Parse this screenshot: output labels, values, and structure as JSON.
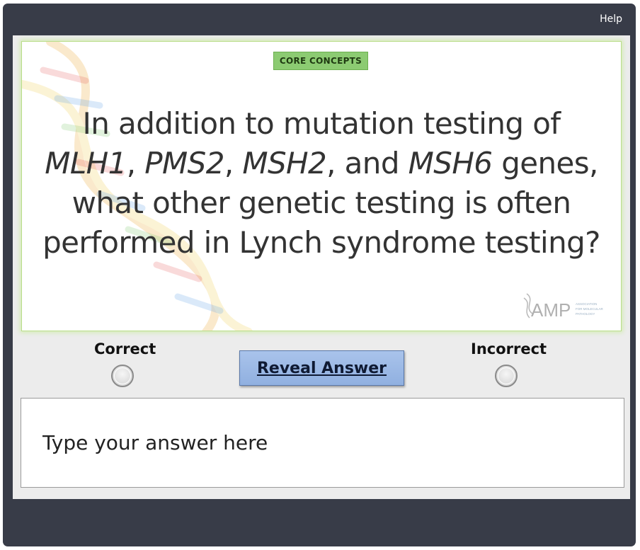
{
  "toolbar": {
    "help_label": "Help"
  },
  "card": {
    "tag": "CORE CONCEPTS",
    "question": {
      "l1": "In addition to mutation testing of",
      "g1": "MLH1",
      "s1": ", ",
      "g2": "PMS2",
      "s2": ", ",
      "g3": "MSH2",
      "s3": ", and ",
      "g4": "MSH6",
      "s4": " genes,",
      "l3": "what other genetic testing is often",
      "l4": "performed in Lynch syndrome testing?"
    },
    "logo": {
      "name": "AMP",
      "sub1": "ASSOCIATION",
      "sub2": "FOR MOLECULAR",
      "sub3": "PATHOLOGY"
    }
  },
  "options": {
    "correct_label": "Correct",
    "incorrect_label": "Incorrect",
    "reveal_label": "Reveal Answer"
  },
  "answer": {
    "placeholder": "Type your answer here"
  },
  "colors": {
    "frame": "#383c48",
    "tag_bg": "#8ccb72",
    "card_border": "#b9dd8a",
    "reveal_button": "#a9c3eb"
  }
}
